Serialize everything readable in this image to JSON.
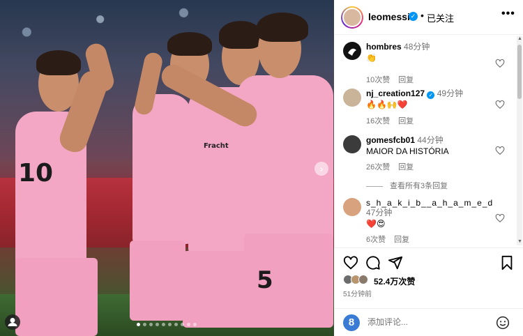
{
  "header": {
    "username": "leomessi",
    "separator": "•",
    "follow_status": "已关注",
    "more": "•••"
  },
  "comments": [
    {
      "user": "hombres",
      "time": "48分钟",
      "text": "👏",
      "likes": "10次赞",
      "reply": "回复"
    },
    {
      "user": "nj_creation127",
      "verified": true,
      "time": "49分钟",
      "text": "🔥🔥🙌❤️",
      "likes": "16次赞",
      "reply": "回复"
    },
    {
      "user": "gomesfcb01",
      "time": "44分钟",
      "text": "MAIOR DA HISTÓRIA",
      "likes": "26次赞",
      "reply": "回复"
    },
    {
      "user": "s_h_a_k_i_b__a_h_a_m_e_d",
      "time": "47分钟",
      "text": "❤️😍",
      "likes": "6次赞",
      "reply": "回复"
    }
  ],
  "view_replies": "查看所有3条回复",
  "post": {
    "likes": "52.4万次赞",
    "time_ago": "51分钟前",
    "comment_placeholder": "添加评论..."
  },
  "photo": {
    "jersey_numbers": [
      "10",
      "5"
    ],
    "sponsor_text": "Fracht"
  },
  "colors": {
    "verified": "#0095f6",
    "jersey_pink": "#f4a7c4",
    "muted_text": "#737373"
  },
  "icons": [
    "heart-icon",
    "comment-icon",
    "share-icon",
    "bookmark-icon",
    "emoji-icon",
    "more-icon",
    "verified-icon",
    "user-tag-icon",
    "next-photo-icon"
  ]
}
